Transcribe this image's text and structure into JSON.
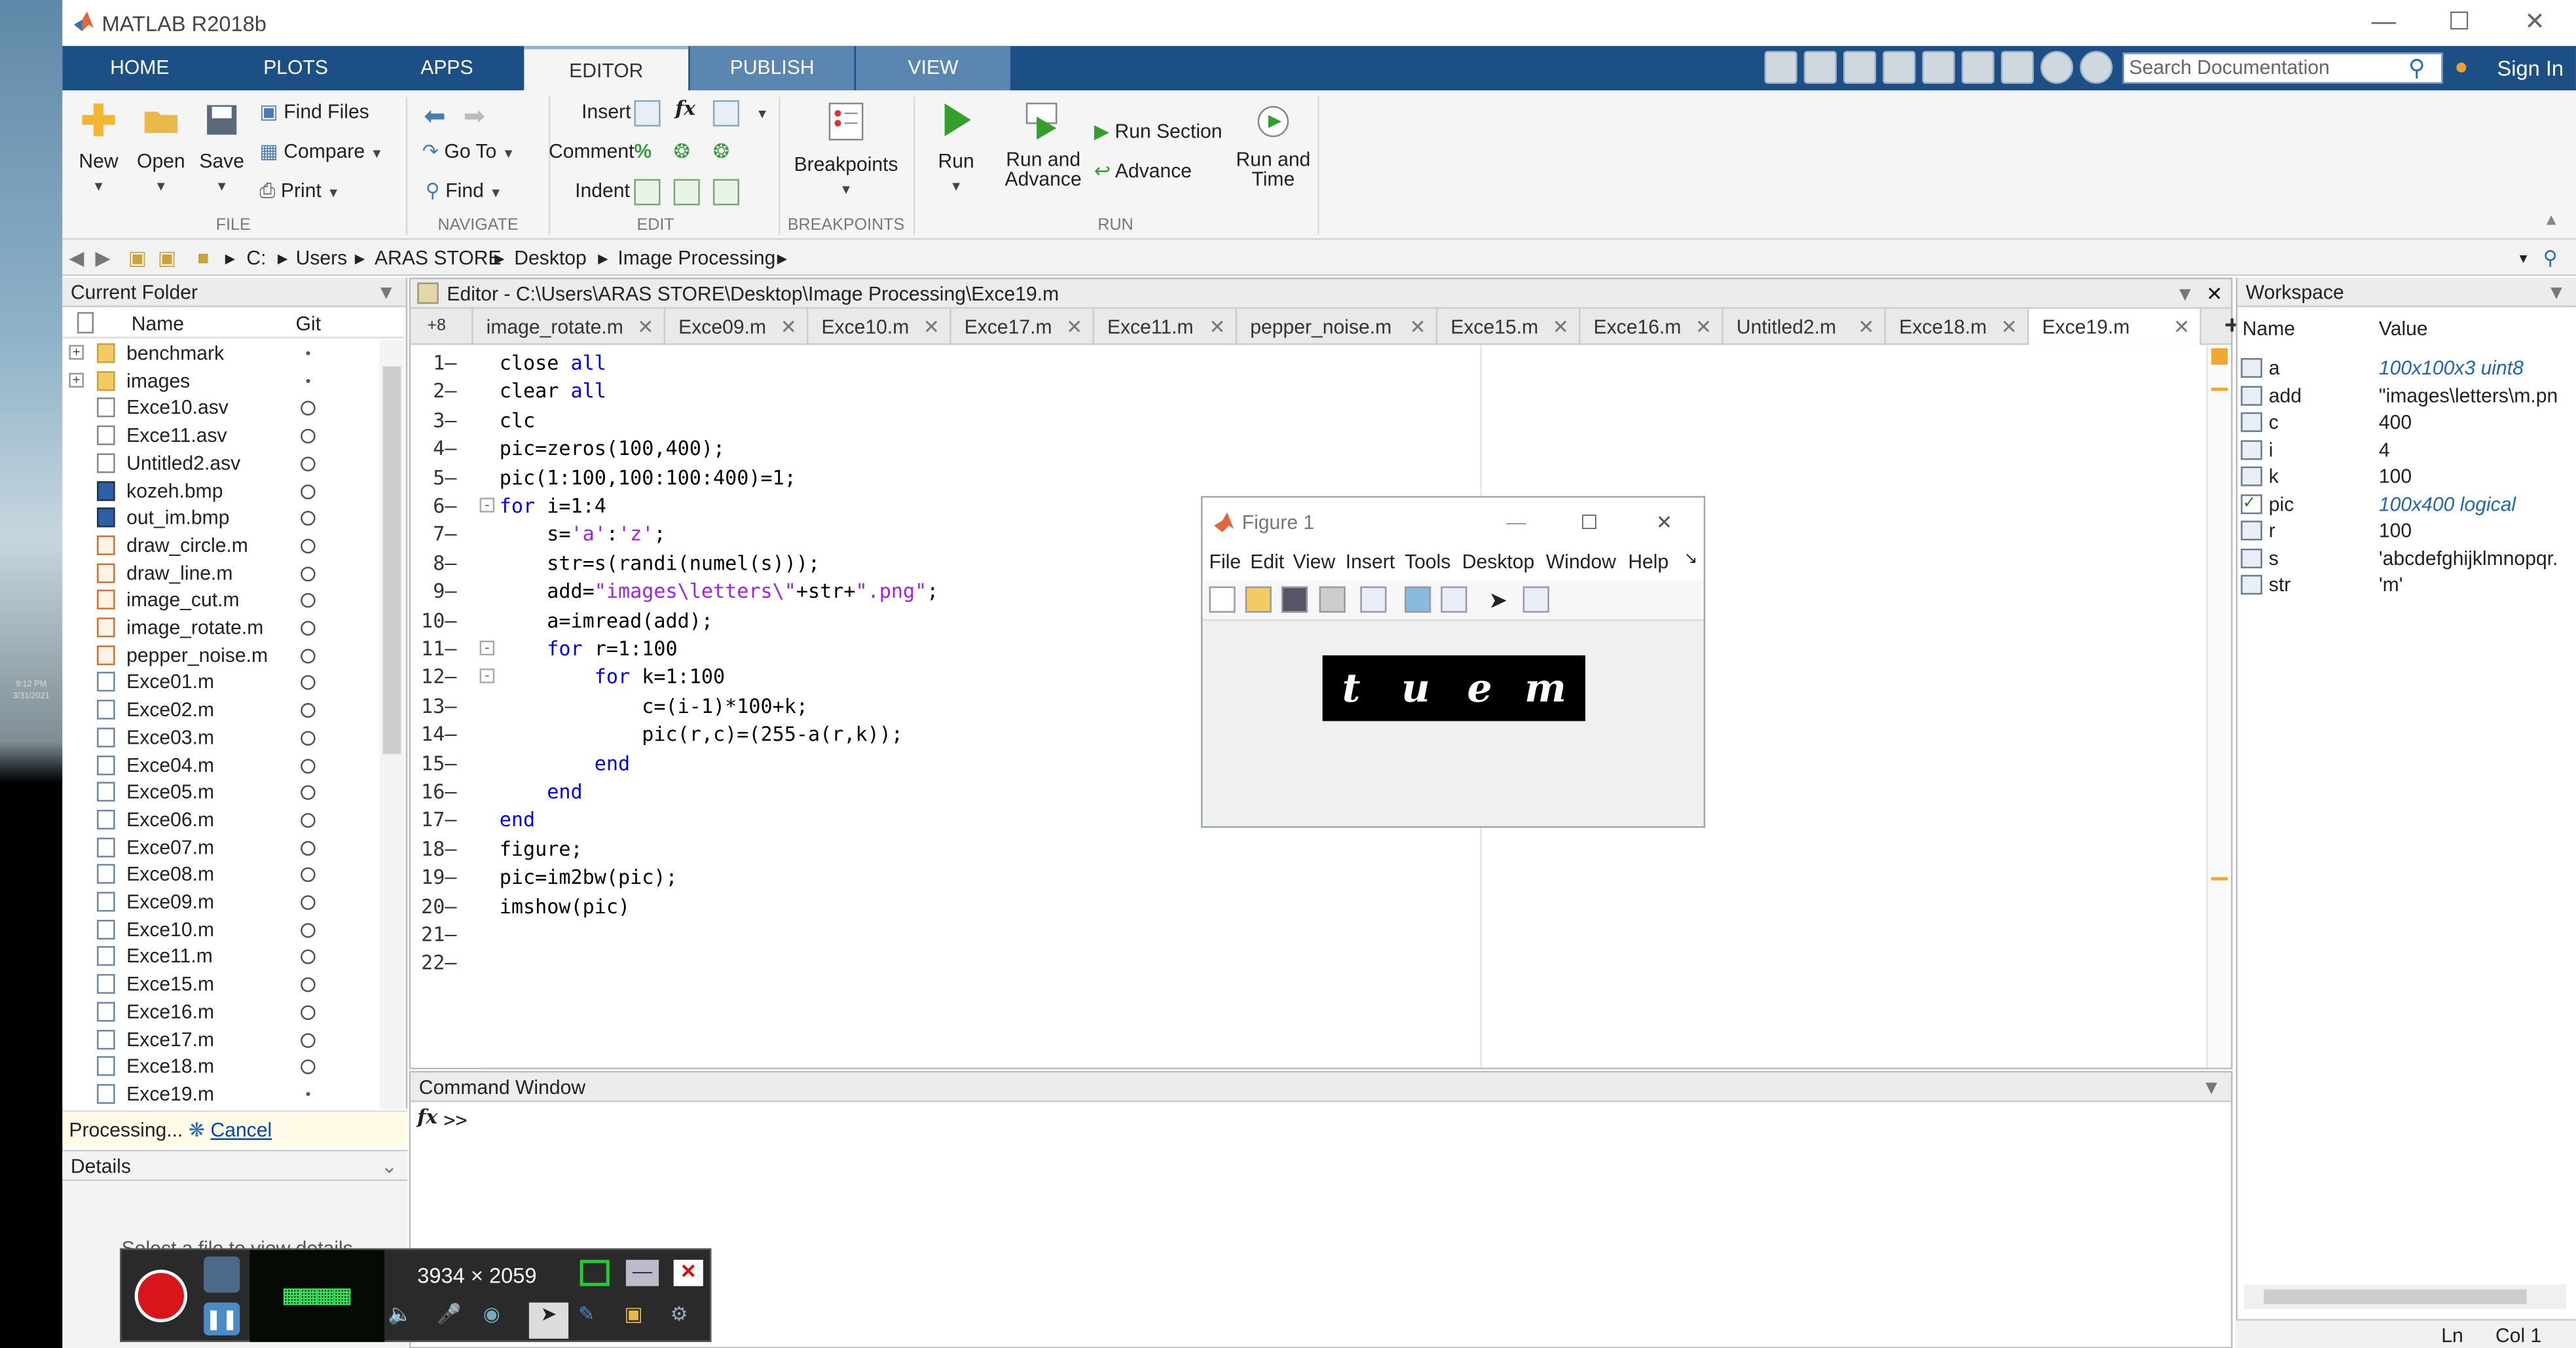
{
  "window": {
    "title": "MATLAB R2018b"
  },
  "ribbon_tabs": [
    "HOME",
    "PLOTS",
    "APPS",
    "EDITOR",
    "PUBLISH",
    "VIEW"
  ],
  "search": {
    "placeholder": "Search Documentation"
  },
  "sign_in": "Sign In",
  "ribbon": {
    "file": {
      "new": "New",
      "open": "Open",
      "save": "Save",
      "find_files": "Find Files",
      "compare": "Compare",
      "print": "Print",
      "group": "FILE"
    },
    "navigate": {
      "go_to": "Go To",
      "find": "Find",
      "group": "NAVIGATE"
    },
    "edit": {
      "insert": "Insert",
      "comment": "Comment",
      "indent": "Indent",
      "fx": "fx",
      "group": "EDIT"
    },
    "breakpoints": {
      "label": "Breakpoints",
      "group": "BREAKPOINTS"
    },
    "run": {
      "run": "Run",
      "run_and_advance_1": "Run and",
      "run_and_advance_2": "Advance",
      "run_section": "Run Section",
      "advance": "Advance",
      "run_and_time_1": "Run and",
      "run_and_time_2": "Time",
      "group": "RUN"
    }
  },
  "address": {
    "parts": [
      "C:",
      "Users",
      "ARAS STORE",
      "Desktop",
      "Image Processing"
    ]
  },
  "current_folder": {
    "title": "Current Folder",
    "col_name": "Name",
    "col_git": "Git",
    "files": [
      {
        "name": "benchmark",
        "type": "folder"
      },
      {
        "name": "images",
        "type": "folder"
      },
      {
        "name": "Exce10.asv",
        "type": "file"
      },
      {
        "name": "Exce11.asv",
        "type": "file"
      },
      {
        "name": "Untitled2.asv",
        "type": "file"
      },
      {
        "name": "kozeh.bmp",
        "type": "image"
      },
      {
        "name": "out_im.bmp",
        "type": "image"
      },
      {
        "name": "draw_circle.m",
        "type": "func"
      },
      {
        "name": "draw_line.m",
        "type": "func"
      },
      {
        "name": "image_cut.m",
        "type": "func"
      },
      {
        "name": "image_rotate.m",
        "type": "func"
      },
      {
        "name": "pepper_noise.m",
        "type": "func"
      },
      {
        "name": "Exce01.m",
        "type": "script"
      },
      {
        "name": "Exce02.m",
        "type": "script"
      },
      {
        "name": "Exce03.m",
        "type": "script"
      },
      {
        "name": "Exce04.m",
        "type": "script"
      },
      {
        "name": "Exce05.m",
        "type": "script"
      },
      {
        "name": "Exce06.m",
        "type": "script"
      },
      {
        "name": "Exce07.m",
        "type": "script"
      },
      {
        "name": "Exce08.m",
        "type": "script"
      },
      {
        "name": "Exce09.m",
        "type": "script"
      },
      {
        "name": "Exce10.m",
        "type": "script"
      },
      {
        "name": "Exce11.m",
        "type": "script"
      },
      {
        "name": "Exce15.m",
        "type": "script"
      },
      {
        "name": "Exce16.m",
        "type": "script"
      },
      {
        "name": "Exce17.m",
        "type": "script"
      },
      {
        "name": "Exce18.m",
        "type": "script"
      },
      {
        "name": "Exce19.m",
        "type": "script"
      }
    ],
    "processing": "Processing...",
    "cancel": "Cancel",
    "details": "Details",
    "details_hint": "Select a file to view details"
  },
  "editor": {
    "title": "Editor - C:\\Users\\ARAS STORE\\Desktop\\Image Processing\\Exce19.m",
    "overflow": "+8",
    "tabs": [
      "image_rotate.m",
      "Exce09.m",
      "Exce10.m",
      "Exce17.m",
      "Exce11.m",
      "pepper_noise.m",
      "Exce15.m",
      "Exce16.m",
      "Untitled2.m",
      "Exce18.m",
      "Exce19.m"
    ],
    "active_tab": "Exce19.m",
    "lines": [
      "close all",
      "clear all",
      "clc",
      "pic=zeros(100,400);",
      "pic(1:100,100:100:400)=1;",
      "for i=1:4",
      "    s='a':'z';",
      "    str=s(randi(numel(s)));",
      "    add=\"images\\letters\\\"+str+\".png\";",
      "    a=imread(add);",
      "    for r=1:100",
      "        for k=1:100",
      "            c=(i-1)*100+k;",
      "            pic(r,c)=(255-a(r,k));",
      "        end",
      "    end",
      "end",
      "figure;",
      "pic=im2bw(pic);",
      "imshow(pic)",
      "",
      ""
    ]
  },
  "command_window": {
    "title": "Command Window",
    "prompt": ">>",
    "fx": "fx"
  },
  "workspace": {
    "title": "Workspace",
    "col_name": "Name",
    "col_value": "Value",
    "vars": [
      {
        "name": "a",
        "value": "100x100x3 uint8"
      },
      {
        "name": "add",
        "value": "\"images\\letters\\m.pn..."
      },
      {
        "name": "c",
        "value": "400"
      },
      {
        "name": "i",
        "value": "4"
      },
      {
        "name": "k",
        "value": "100"
      },
      {
        "name": "pic",
        "value": "100x400 logical"
      },
      {
        "name": "r",
        "value": "100"
      },
      {
        "name": "s",
        "value": "'abcdefghijklmnopqr..."
      },
      {
        "name": "str",
        "value": "'m'"
      }
    ]
  },
  "figure": {
    "title": "Figure 1",
    "menu": [
      "File",
      "Edit",
      "View",
      "Insert",
      "Tools",
      "Desktop",
      "Window",
      "Help"
    ],
    "letters": [
      "t",
      "u",
      "e",
      "m"
    ]
  },
  "recorder": {
    "dims": "3934 × 2059"
  },
  "status": {
    "ln": "Ln",
    "col": "Col 1"
  },
  "desktop_clock": {
    "time": "9:12 PM",
    "date": "3/31/2021"
  },
  "colors": {
    "tab_bar": "#1b4f86",
    "keyword": "#0000ff",
    "string": "#a020f0"
  }
}
